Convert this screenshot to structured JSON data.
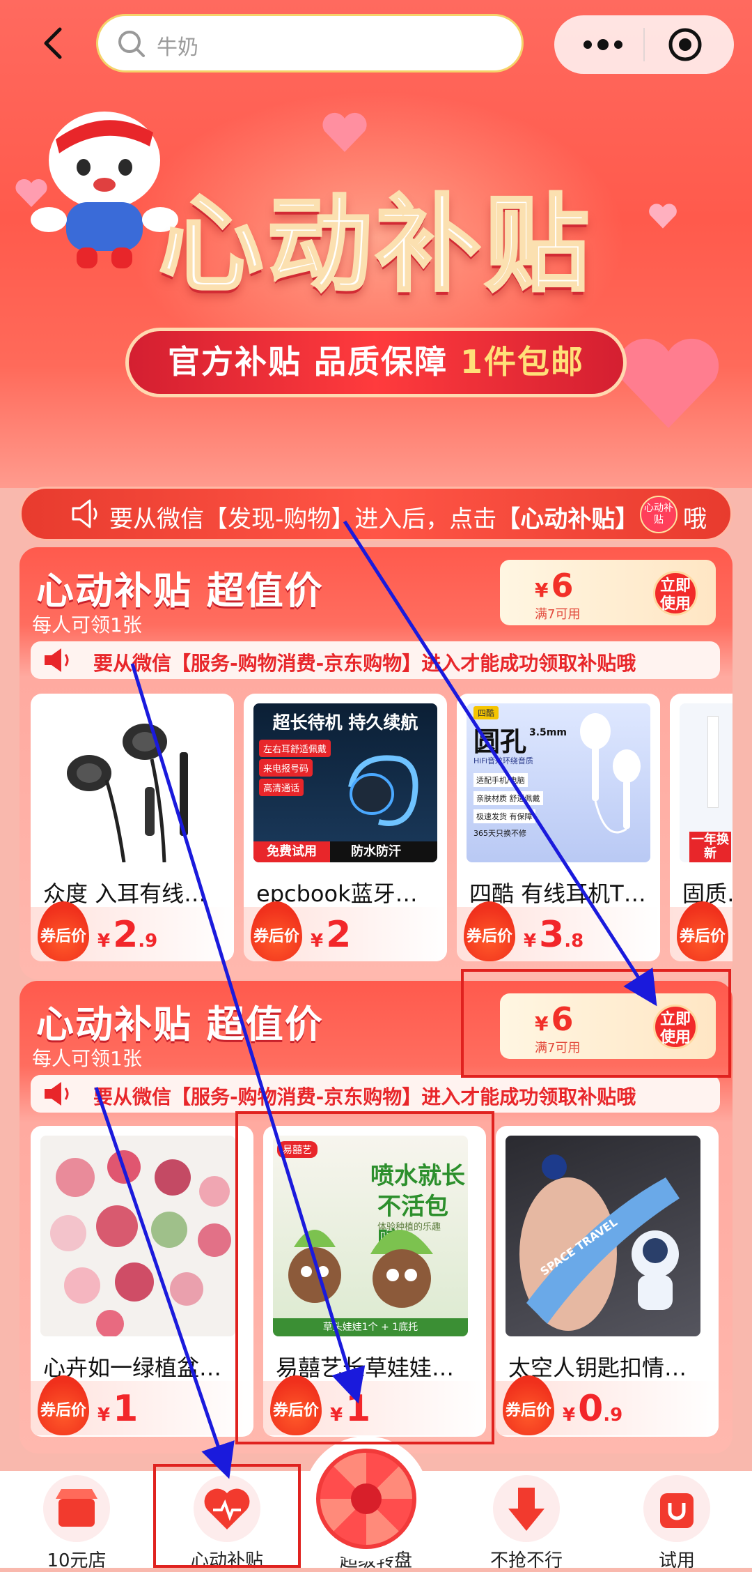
{
  "search": {
    "placeholder": "牛奶"
  },
  "hero": {
    "title": "心动补贴",
    "banner_a": "官方补贴 品质保障 ",
    "banner_b": "1件包邮"
  },
  "notice": {
    "text_a": "要从微信【发现-购物】进入后，点击",
    "text_b": "【心动补贴】",
    "text_c": "哦",
    "badge": "心动补贴"
  },
  "sections": [
    {
      "title": "心动补贴 超值价",
      "subtitle": "每人可领1张",
      "coupon": {
        "currency": "¥",
        "amount": "6",
        "condition": "满7可用",
        "use_label": "立即使用"
      },
      "tip": "要从微信【服务-购物消费-京东购物】进入才能成功领取补贴哦",
      "products": [
        {
          "name": "众度 入耳有线…",
          "price_int": "2",
          "price_dec": ".9",
          "price_label": "券后价"
        },
        {
          "name": "epcbook蓝牙…",
          "price_int": "2",
          "price_dec": "",
          "price_label": "券后价",
          "img_text": [
            "超长待机 持久续航",
            "左右耳舒适佩戴",
            "来电报号码",
            "高清通话",
            "免费试用",
            "防水防汗"
          ]
        },
        {
          "name": "四酷 有线耳机T…",
          "price_int": "3",
          "price_dec": ".8",
          "price_label": "券后价",
          "img_text": [
            "四酷",
            "圆孔",
            "3.5mm",
            "HiFi音效环绕音质",
            "适配手机/电脑",
            "亲肤材质 舒适佩戴",
            "极速发货 有保障",
            "365天只换不修"
          ]
        },
        {
          "name": "固质…",
          "price_int": "",
          "price_dec": "",
          "price_label": "券后价",
          "img_text": [
            "一年换新"
          ]
        }
      ]
    },
    {
      "title": "心动补贴 超值价",
      "subtitle": "每人可领1张",
      "coupon": {
        "currency": "¥",
        "amount": "6",
        "condition": "满7可用",
        "use_label": "立即使用"
      },
      "tip": "要从微信【服务-购物消费-京东购物】进入才能成功领取补贴哦",
      "products": [
        {
          "name": "心卉如一绿植盆…",
          "price_int": "1",
          "price_dec": "",
          "price_label": "券后价"
        },
        {
          "name": "易囍艺长草娃娃…",
          "price_int": "1",
          "price_dec": "",
          "price_label": "券后价",
          "img_text": [
            "易囍艺",
            "喷水就长",
            "不活包赔",
            "体验种植的乐趣",
            "草头娃娃1个 + 1底托"
          ]
        },
        {
          "name": "太空人钥匙扣情…",
          "price_int": "0",
          "price_dec": ".9",
          "price_label": "券后价",
          "img_text": [
            "SPACE TRAVEL"
          ]
        }
      ]
    }
  ],
  "tabs": [
    {
      "label": "10元店"
    },
    {
      "label": "心动补贴"
    },
    {
      "label": "超级转盘"
    },
    {
      "label": "不抢不行"
    },
    {
      "label": "试用"
    }
  ],
  "colors": {
    "accent": "#f2262a",
    "annotation_arrow": "#1a1adc",
    "annotation_box": "#e0221f"
  }
}
